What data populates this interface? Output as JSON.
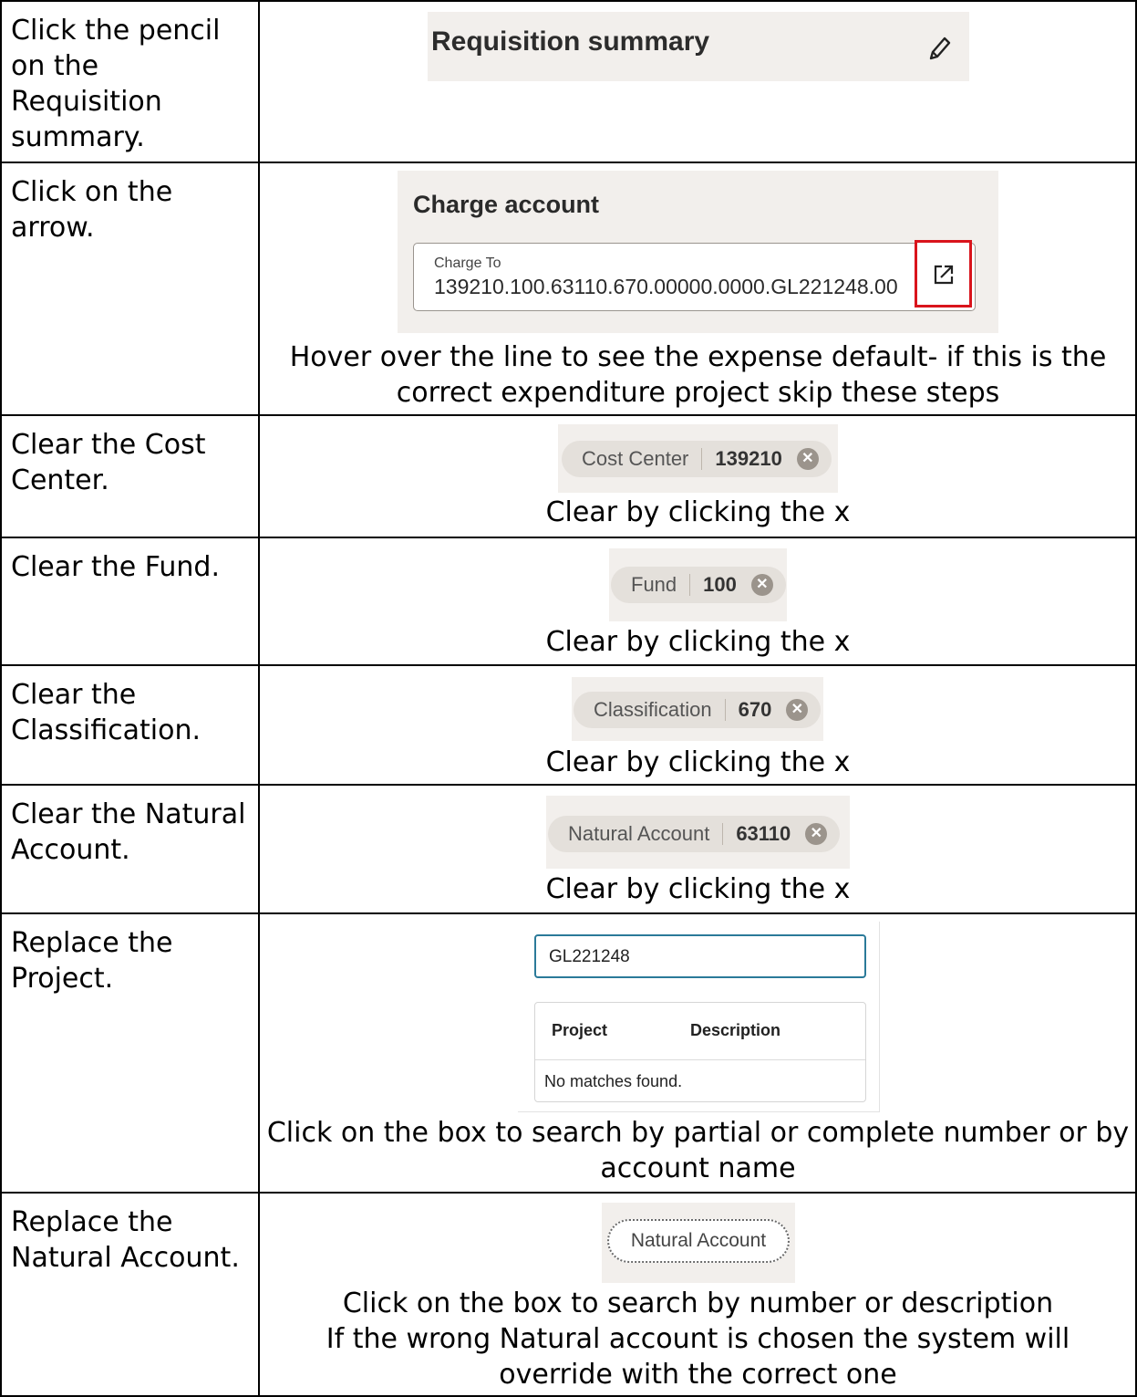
{
  "steps": [
    {
      "instruction": "Click the pencil on the Requisition summary.",
      "summary_title": "Requisition summary",
      "icon": "pencil-icon"
    },
    {
      "instruction": "Click on the arrow.",
      "section_title": "Charge account",
      "field_label": "Charge To",
      "field_value": "139210.100.63110.670.00000.0000.GL221248.00",
      "icon": "external-link-icon",
      "caption": "Hover over the line to see the expense default- if this is the correct expenditure project skip these steps"
    },
    {
      "instruction": "Clear the Cost Center.",
      "chip_label": "Cost Center",
      "chip_value": "139210",
      "caption": "Clear by clicking the x"
    },
    {
      "instruction": "Clear the Fund.",
      "chip_label": "Fund",
      "chip_value": "100",
      "caption": "Clear by clicking the x"
    },
    {
      "instruction": "Clear the Classification.",
      "chip_label": "Classification",
      "chip_value": "670",
      "caption": "Clear by clicking the x"
    },
    {
      "instruction": "Clear the Natural Account.",
      "chip_label": "Natural Account",
      "chip_value": "63110",
      "caption": "Clear by clicking the x"
    },
    {
      "instruction": "Replace the Project.",
      "search_value": "GL221248",
      "col_project": "Project",
      "col_description": "Description",
      "empty_text": "No matches found.",
      "caption": "Click on the box to search by partial or complete number or by account name"
    },
    {
      "instruction": "Replace the Natural Account.",
      "button_label": "Natural Account",
      "caption_line1": "Click on the box to search by number or description",
      "caption_line2": "If the wrong Natural account is chosen the system will override with the correct one"
    }
  ],
  "colors": {
    "highlight_box": "#d9141c",
    "search_border": "#2b7a99"
  }
}
